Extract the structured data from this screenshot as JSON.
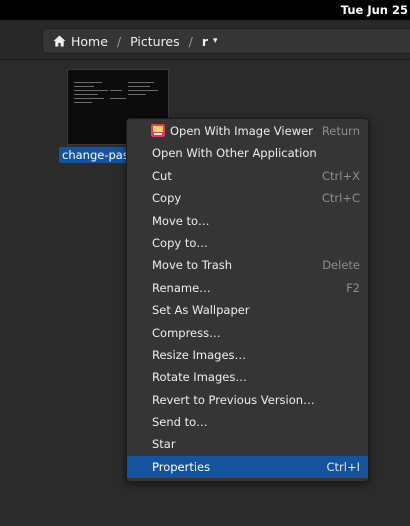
{
  "topbar": {
    "clock": "Tue Jun 25"
  },
  "pathbar": {
    "home_label": "Home",
    "separator": "/",
    "segment_pictures": "Pictures",
    "segment_current": "r",
    "caret": "▾"
  },
  "file": {
    "label": "change-pas"
  },
  "context_menu": {
    "items": [
      {
        "label": "Open With Image Viewer",
        "shortcut": "Return",
        "icon": "image-viewer-icon"
      },
      {
        "label": "Open With Other Application",
        "shortcut": ""
      },
      {
        "label": "Cut",
        "shortcut": "Ctrl+X"
      },
      {
        "label": "Copy",
        "shortcut": "Ctrl+C"
      },
      {
        "label": "Move to…",
        "shortcut": ""
      },
      {
        "label": "Copy to…",
        "shortcut": ""
      },
      {
        "label": "Move to Trash",
        "shortcut": "Delete"
      },
      {
        "label": "Rename…",
        "shortcut": "F2"
      },
      {
        "label": "Set As Wallpaper",
        "shortcut": ""
      },
      {
        "label": "Compress…",
        "shortcut": ""
      },
      {
        "label": "Resize Images…",
        "shortcut": ""
      },
      {
        "label": "Rotate Images…",
        "shortcut": ""
      },
      {
        "label": "Revert to Previous Version…",
        "shortcut": ""
      },
      {
        "label": "Send to…",
        "shortcut": ""
      },
      {
        "label": "Star",
        "shortcut": ""
      },
      {
        "label": "Properties",
        "shortcut": "Ctrl+I",
        "active": true
      }
    ]
  },
  "colors": {
    "accent": "#15539e",
    "background": "#2b2b2b",
    "menu_background": "#353535",
    "topbar": "#000000"
  }
}
